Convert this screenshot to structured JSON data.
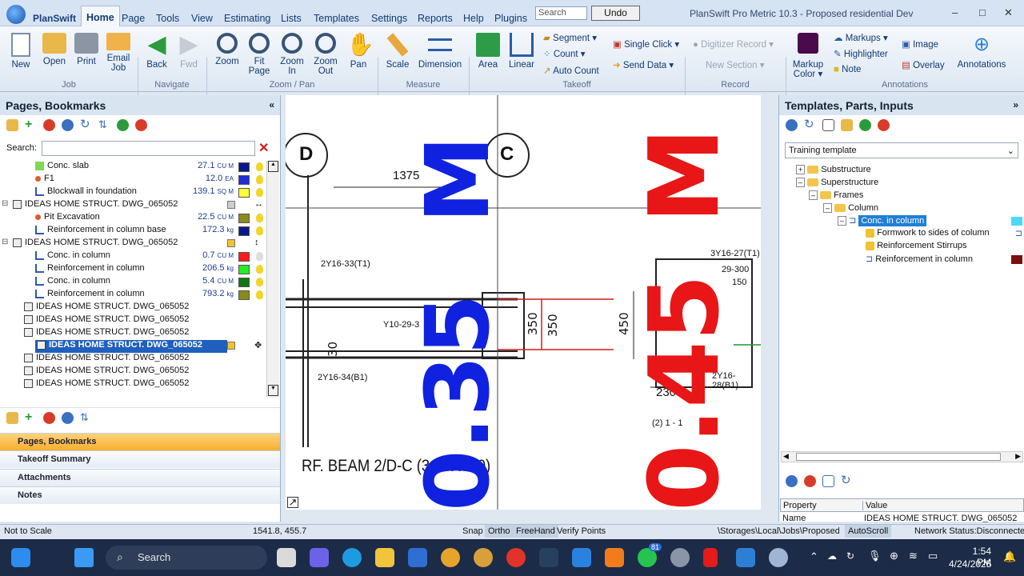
{
  "app": {
    "logo_text": "PlanSwift",
    "window_title": "PlanSwift Pro Metric 10.3 - Proposed residential Dev",
    "menu": [
      "Home",
      "Page",
      "Tools",
      "View",
      "Estimating",
      "Lists",
      "Templates",
      "Settings",
      "Reports",
      "Help",
      "Plugins"
    ],
    "search_placeholder": "Search",
    "undo_label": "Undo",
    "window_controls": [
      "–",
      "□",
      "✕"
    ]
  },
  "ribbon": {
    "groups": [
      "Job",
      "Navigate",
      "Zoom / Pan",
      "Measure",
      "Takeoff",
      "Record",
      "Annotations"
    ],
    "job": [
      "New",
      "Open",
      "Print",
      "Email Job"
    ],
    "navigate": [
      "Back",
      "Fwd"
    ],
    "zoom": [
      "Zoom",
      "Fit Page",
      "Zoom In",
      "Zoom Out",
      "Pan"
    ],
    "measure": [
      "Scale",
      "Dimension"
    ],
    "takeoff_big": [
      "Area",
      "Linear"
    ],
    "takeoff_small": [
      "Segment",
      "Count",
      "Auto Count"
    ],
    "send": [
      "Single Click",
      "Send Data"
    ],
    "record": [
      "Digitizer Record",
      "New Section"
    ],
    "markup_color": "Markup Color",
    "annotations_small": [
      "Markups",
      "Highlighter",
      "Note"
    ],
    "annotations_other": [
      "Image",
      "Overlay",
      "Annotations"
    ]
  },
  "left_panel": {
    "title": "Pages, Bookmarks",
    "search_label": "Search:",
    "rows": [
      {
        "label": "Conc. slab",
        "qty": "27.1",
        "unit": "CU M",
        "color": "#0a1a8c"
      },
      {
        "label": "F1",
        "qty": "12.0",
        "unit": "EA",
        "color": "#1d2fd6"
      },
      {
        "label": "Blockwall in foundation",
        "qty": "139.1",
        "unit": "SQ M",
        "color": "#ffff33"
      },
      {
        "label": "IDEAS HOME STRUCT. DWG_065052",
        "qty": "",
        "unit": "",
        "color": ""
      },
      {
        "label": "Pit Excavation",
        "qty": "22.5",
        "unit": "CU M",
        "color": "#8b8b1c"
      },
      {
        "label": "Reinforcement in column base",
        "qty": "172.3",
        "unit": "kg",
        "color": "#0a1a8c"
      },
      {
        "label": "IDEAS HOME STRUCT. DWG_065052",
        "qty": "",
        "unit": "",
        "color": ""
      },
      {
        "label": "Conc. in column",
        "qty": "0.7",
        "unit": "CU M",
        "color": "#ff1a1a"
      },
      {
        "label": "Reinforcement in column",
        "qty": "206.5",
        "unit": "kg",
        "color": "#22ee22"
      },
      {
        "label": "Conc. in column",
        "qty": "5.4",
        "unit": "CU M",
        "color": "#117711"
      },
      {
        "label": "Reinforcement in column",
        "qty": "793.2",
        "unit": "kg",
        "color": "#8a8a1c"
      },
      {
        "label": "IDEAS HOME STRUCT. DWG_065052",
        "qty": "",
        "unit": "",
        "color": ""
      },
      {
        "label": "IDEAS HOME STRUCT. DWG_065052",
        "qty": "",
        "unit": "",
        "color": ""
      },
      {
        "label": "IDEAS HOME STRUCT. DWG_065052",
        "qty": "",
        "unit": "",
        "color": ""
      },
      {
        "label": "IDEAS HOME STRUCT. DWG_065052",
        "qty": "",
        "unit": "",
        "color": ""
      },
      {
        "label": "IDEAS HOME STRUCT. DWG_065052",
        "qty": "",
        "unit": "",
        "color": ""
      },
      {
        "label": "IDEAS HOME STRUCT. DWG_065052",
        "qty": "",
        "unit": "",
        "color": ""
      },
      {
        "label": "IDEAS HOME STRUCT. DWG_065052",
        "qty": "",
        "unit": "",
        "color": ""
      }
    ],
    "nav": [
      "Pages, Bookmarks",
      "Takeoff Summary",
      "Attachments",
      "Notes"
    ]
  },
  "drawing": {
    "grid_d": "D",
    "grid_c": "C",
    "dim_1375": "1375",
    "t1": "2Y16-33(T1)",
    "y10": "Y10-29-3",
    "b1": "2Y16-34(B1)",
    "d350a": "350",
    "d350b": "350",
    "d450": "450",
    "d230": "230",
    "d30": "30",
    "sec": "(2) 1 - 1",
    "rt1": "3Y16-27(T1)",
    "r300": "29-300",
    "r150": "150",
    "rb1": "2Y16-28(B1)",
    "beam": "RF. BEAM 2/D-C (3CCX600)",
    "big_blue_top": "M",
    "big_blue_bottom": "0.35",
    "big_red_top": "M",
    "big_red_bottom": "0.45"
  },
  "right_panel": {
    "title": "Templates, Parts, Inputs",
    "template": "Training template",
    "tree": [
      "Substructure",
      "Superstructure",
      "Frames",
      "Column",
      "Conc. in column",
      "Formwork to sides of column",
      "Reinforcement Stirrups",
      "Reinforcement in column"
    ],
    "prop_headers": [
      "Property",
      "Value"
    ],
    "prop_row": [
      "Name",
      "IDEAS HOME STRUCT. DWG_065052"
    ]
  },
  "status": {
    "scale": "Not to Scale",
    "coords": "1541.8, 455.7",
    "snap": "Snap",
    "ortho": "Ortho",
    "freehand": "FreeHand",
    "verify": "Verify Points",
    "path": "\\Storages\\Local\\Jobs\\Proposed re",
    "autoscroll": "AutoScroll",
    "network": "Network Status:Disconnected"
  },
  "taskbar": {
    "search": "Search",
    "time": "1:54 PM",
    "date": "4/24/2025",
    "badge": "81"
  }
}
